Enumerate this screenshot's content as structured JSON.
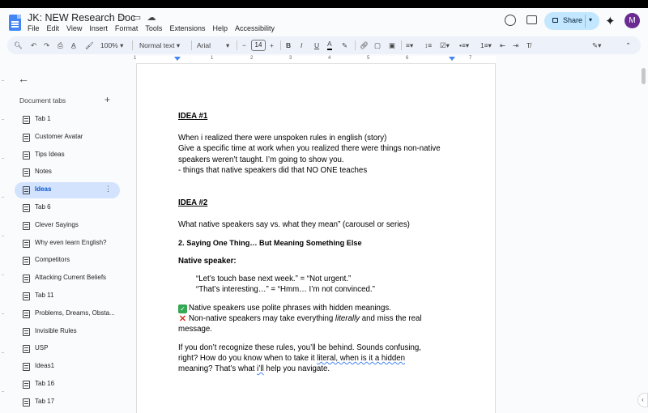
{
  "doc_title": "JK: NEW Research Doc",
  "menu": [
    "File",
    "Edit",
    "View",
    "Insert",
    "Format",
    "Tools",
    "Extensions",
    "Help",
    "Accessibility"
  ],
  "share_label": "Share",
  "avatar_initial": "M",
  "toolbar": {
    "zoom": "100%",
    "style": "Normal text",
    "font": "Arial",
    "font_size": "14"
  },
  "ruler_numbers": [
    "1",
    "1",
    "2",
    "3",
    "4",
    "5",
    "6",
    "7"
  ],
  "sidebar": {
    "heading": "Document tabs",
    "tabs": [
      {
        "label": "Tab 1",
        "active": false
      },
      {
        "label": "Customer Avatar",
        "active": false
      },
      {
        "label": "Tips Ideas",
        "active": false
      },
      {
        "label": "Notes",
        "active": false
      },
      {
        "label": "Ideas",
        "active": true
      },
      {
        "label": "Tab 6",
        "active": false
      },
      {
        "label": "Clever Sayings",
        "active": false
      },
      {
        "label": "Why even learn English?",
        "active": false
      },
      {
        "label": "Competitors",
        "active": false
      },
      {
        "label": "Attacking Current Beliefs",
        "active": false
      },
      {
        "label": "Tab 11",
        "active": false
      },
      {
        "label": "Problems, Dreams, Obsta...",
        "active": false
      },
      {
        "label": "Invisible Rules",
        "active": false
      },
      {
        "label": "USP",
        "active": false
      },
      {
        "label": "Ideas1",
        "active": false
      },
      {
        "label": "Tab 16",
        "active": false
      },
      {
        "label": "Tab 17",
        "active": false
      }
    ]
  },
  "document": {
    "idea1_heading": "IDEA #1",
    "idea1_line1": "When i realized there were unspoken rules in english (story)",
    "idea1_line2": "Give a specific time at work when you realized there were things non-native",
    "idea1_line3": "speakers weren’t taught. I’m going to show you.",
    "idea1_line4": "- things that native speakers did that NO ONE teaches",
    "idea2_heading": "IDEA #2",
    "idea2_line1": "What native speakers say vs. what they mean” (carousel or series)",
    "idea2_sub": "2. Saying One Thing… But Meaning Something Else",
    "native_label": "Native speaker:",
    "quote1": "“Let’s touch base next week.” = “Not urgent.”",
    "quote2": "“That’s interesting…” = “Hmm… I’m not convinced.”",
    "check_line": "Native speakers use polite phrases with hidden meanings.",
    "x_line_pre": "Non-native speakers may take everything ",
    "x_line_em": "literally",
    "x_line_post": " and miss the real",
    "x_line2": "message.",
    "para1": "If you don’t recognize these rules, you’ll be behind. Sounds confusing,",
    "para2_pre": "right? How do you know when to take it ",
    "para2_sq": "literal, when is it a hidden",
    "para3_pre": "meaning? That’s what ",
    "para3_sq": "i’ll",
    "para3_post": " help you navigate."
  }
}
